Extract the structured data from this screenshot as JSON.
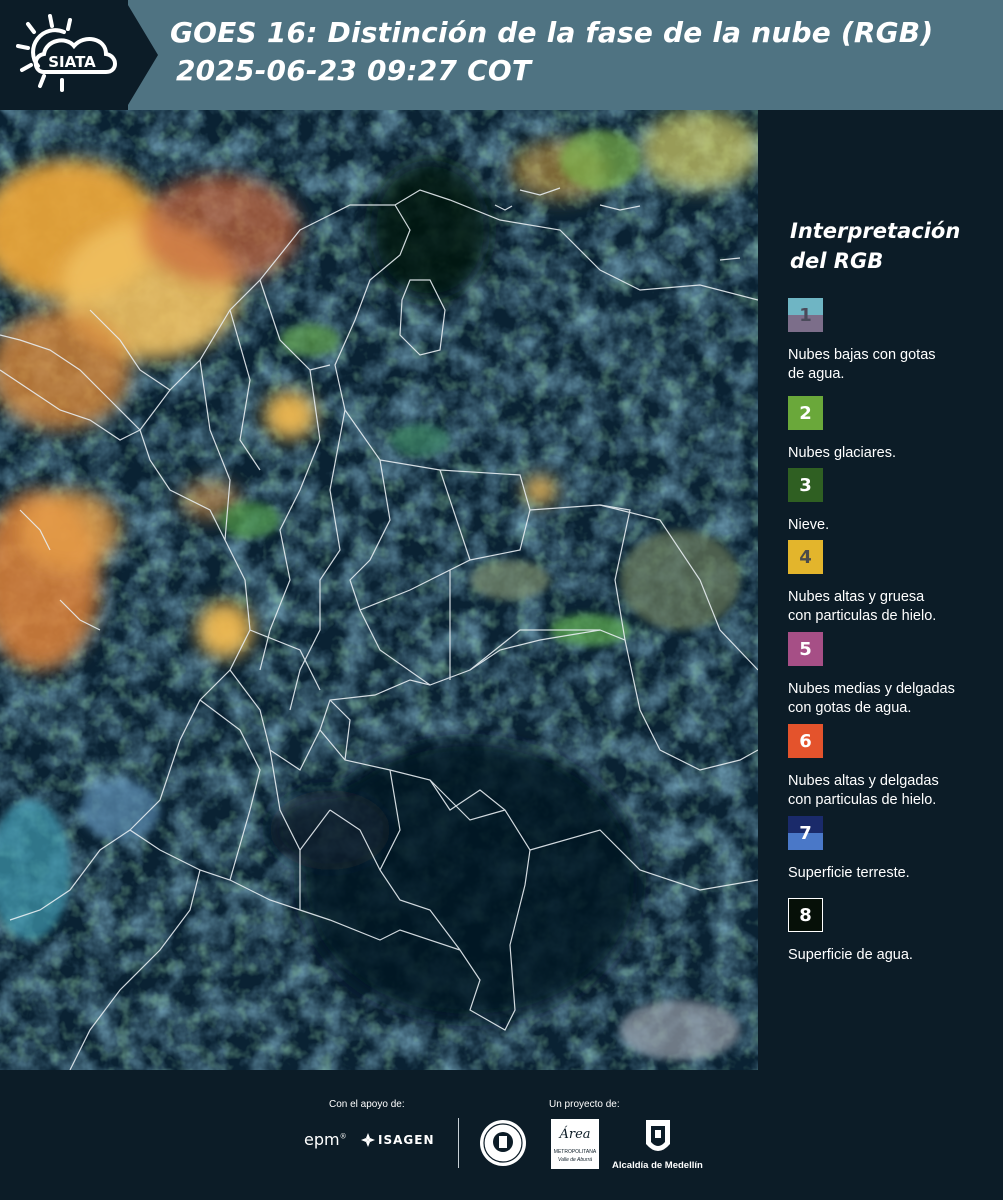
{
  "header": {
    "logo_text": "SIATA",
    "title_line1": "GOES 16: Distinción de la fase de la nube (RGB)",
    "title_line2": "2025-06-23 09:27 COT"
  },
  "legend": {
    "title_line1": "Interpretación",
    "title_line2": "del RGB",
    "items": [
      {
        "number": "1",
        "label_line1": "Nubes bajas con gotas",
        "label_line2": "de agua.",
        "color_top": "#6fb5c4",
        "color_bottom": "#7c6e8a",
        "number_color": "#4a4a5a"
      },
      {
        "number": "2",
        "label_line1": "Nubes glaciares.",
        "label_line2": "",
        "color_top": "#6aa83a",
        "color_bottom": "#6aa83a",
        "number_color": "#ffffff"
      },
      {
        "number": "3",
        "label_line1": "Nieve.",
        "label_line2": "",
        "color_top": "#2f5f22",
        "color_bottom": "#2f5f22",
        "number_color": "#ffffff"
      },
      {
        "number": "4",
        "label_line1": "Nubes altas y gruesa",
        "label_line2": "con particulas de hielo.",
        "color_top": "#e3b52c",
        "color_bottom": "#e3b52c",
        "number_color": "#4a4a4a"
      },
      {
        "number": "5",
        "label_line1": "Nubes medias y delgadas",
        "label_line2": "con gotas de agua.",
        "color_top": "#a64f86",
        "color_bottom": "#a64f86",
        "number_color": "#ffffff"
      },
      {
        "number": "6",
        "label_line1": "Nubes altas y delgadas",
        "label_line2": "con particulas de hielo.",
        "color_top": "#e4532c",
        "color_bottom": "#e4532c",
        "number_color": "#ffffff"
      },
      {
        "number": "7",
        "label_line1": "Superficie terreste.",
        "label_line2": "",
        "color_top": "#1a2a6a",
        "color_bottom": "#4a78c8",
        "number_color": "#ffffff"
      },
      {
        "number": "8",
        "label_line1": "Superficie de agua.",
        "label_line2": "",
        "color_top": "#061008",
        "color_bottom": "#061008",
        "number_color": "#ffffff"
      }
    ]
  },
  "footer": {
    "support_label": "Con el apoyo de:",
    "project_label": "Un proyecto de:",
    "sponsor1": "epm",
    "sponsor2": "ISAGEN",
    "partner_area": "Área",
    "partner_area_sub1": "METROPOLITANA",
    "partner_area_sub2": "Valle de Aburrá",
    "partner_alcaldia": "Alcaldía de Medellín"
  },
  "colors": {
    "header_band": "#4f7382",
    "background": "#0c1c27",
    "map_ocean": "#08202e"
  }
}
